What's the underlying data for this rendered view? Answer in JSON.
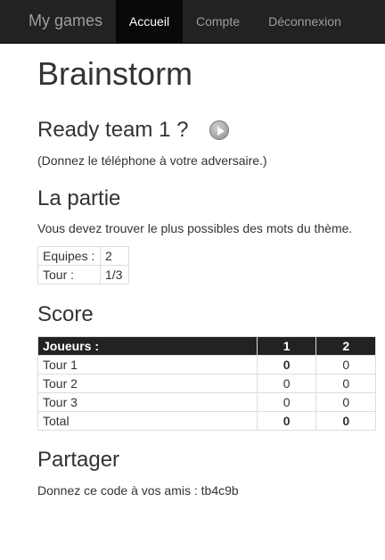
{
  "navbar": {
    "brand": "My games",
    "items": [
      {
        "label": "Accueil",
        "active": true
      },
      {
        "label": "Compte",
        "active": false
      },
      {
        "label": "Déconnexion",
        "active": false
      }
    ]
  },
  "page": {
    "title": "Brainstorm",
    "ready": {
      "title": "Ready team 1 ?",
      "note": "(Donnez le téléphone à votre adversaire.)",
      "play_icon": "play-icon"
    },
    "partie": {
      "title": "La partie",
      "description": "Vous devez trouver le plus possibles des mots du thème.",
      "rows": [
        {
          "label": "Equipes :",
          "value": "2"
        },
        {
          "label": "Tour :",
          "value": "1/3"
        }
      ]
    },
    "score": {
      "title": "Score",
      "headers": [
        "Joueurs :",
        "1",
        "2"
      ],
      "rows": [
        {
          "name": "Tour 1",
          "t1": "0",
          "t2": "0"
        },
        {
          "name": "Tour 2",
          "t1": "0",
          "t2": "0"
        },
        {
          "name": "Tour 3",
          "t1": "0",
          "t2": "0"
        },
        {
          "name": "Total",
          "t1": "0",
          "t2": "0"
        }
      ]
    },
    "partager": {
      "title": "Partager",
      "text": "Donnez ce code à vos amis : tb4c9b"
    }
  },
  "colors": {
    "navbar_bg": "#222222",
    "nav_active_bg": "#080808",
    "table_header_bg": "#222222"
  }
}
